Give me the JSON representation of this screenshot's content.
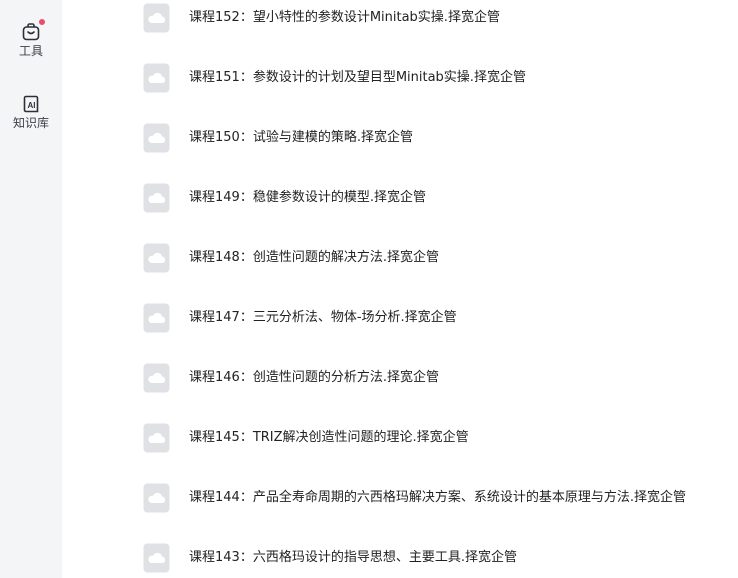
{
  "sidebar": {
    "items": [
      {
        "label": "工具",
        "icon": "toolbox-icon",
        "has_badge": true,
        "badge_color": "#f2496b"
      },
      {
        "label": "知识库",
        "icon": "knowledge-base-icon",
        "has_badge": false
      }
    ]
  },
  "files": [
    {
      "name": "课程152：望小特性的参数设计Minitab实操.择宽企管",
      "icon": "cloud-file-icon"
    },
    {
      "name": "课程151：参数设计的计划及望目型Minitab实操.择宽企管",
      "icon": "cloud-file-icon"
    },
    {
      "name": "课程150：试验与建模的策略.择宽企管",
      "icon": "cloud-file-icon"
    },
    {
      "name": "课程149：稳健参数设计的模型.择宽企管",
      "icon": "cloud-file-icon"
    },
    {
      "name": "课程148：创造性问题的解决方法.择宽企管",
      "icon": "cloud-file-icon"
    },
    {
      "name": "课程147：三元分析法、物体-场分析.择宽企管",
      "icon": "cloud-file-icon"
    },
    {
      "name": "课程146：创造性问题的分析方法.择宽企管",
      "icon": "cloud-file-icon"
    },
    {
      "name": "课程145：TRIZ解决创造性问题的理论.择宽企管",
      "icon": "cloud-file-icon"
    },
    {
      "name": "课程144：产品全寿命周期的六西格玛解决方案、系统设计的基本原理与方法.择宽企管",
      "icon": "cloud-file-icon"
    },
    {
      "name": "课程143：六西格玛设计的指导思想、主要工具.择宽企管",
      "icon": "cloud-file-icon"
    }
  ]
}
